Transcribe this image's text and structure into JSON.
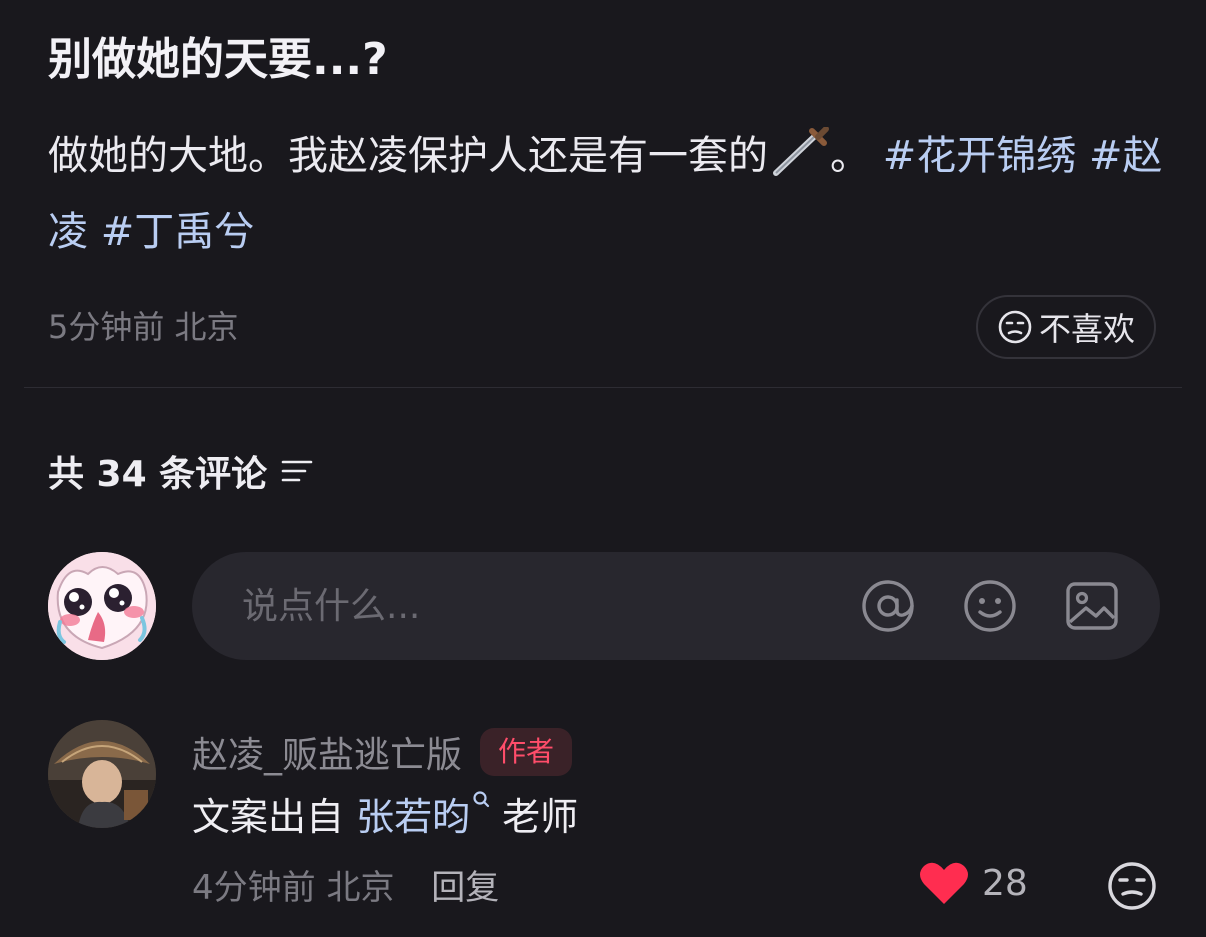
{
  "post": {
    "title": "别做她的天要...?",
    "body_text": "做她的大地。我赵凌保护人还是有一套的",
    "body_after_emoji": "。",
    "emoji_icon": "dagger-icon",
    "hashtags": [
      "#花开锦绣",
      "#赵凌",
      "#丁禹兮"
    ],
    "time": "5分钟前",
    "location": "北京",
    "dislike_label": "不喜欢"
  },
  "comments_section": {
    "header": "共 34 条评论",
    "input_placeholder": "说点什么...",
    "input_icons": [
      "at-icon",
      "emoji-icon",
      "image-icon"
    ]
  },
  "comment": {
    "author": "赵凌_贩盐逃亡版",
    "badge": "作者",
    "text_prefix": "文案出自",
    "mention": "张若昀",
    "text_suffix": "老师",
    "time": "4分钟前",
    "location": "北京",
    "reply_label": "回复",
    "like_count": "28"
  },
  "colors": {
    "background": "#19181d",
    "hashtag": "#b9cdf2",
    "badge_text": "#ff4d6a",
    "like_heart": "#ff2d50"
  }
}
